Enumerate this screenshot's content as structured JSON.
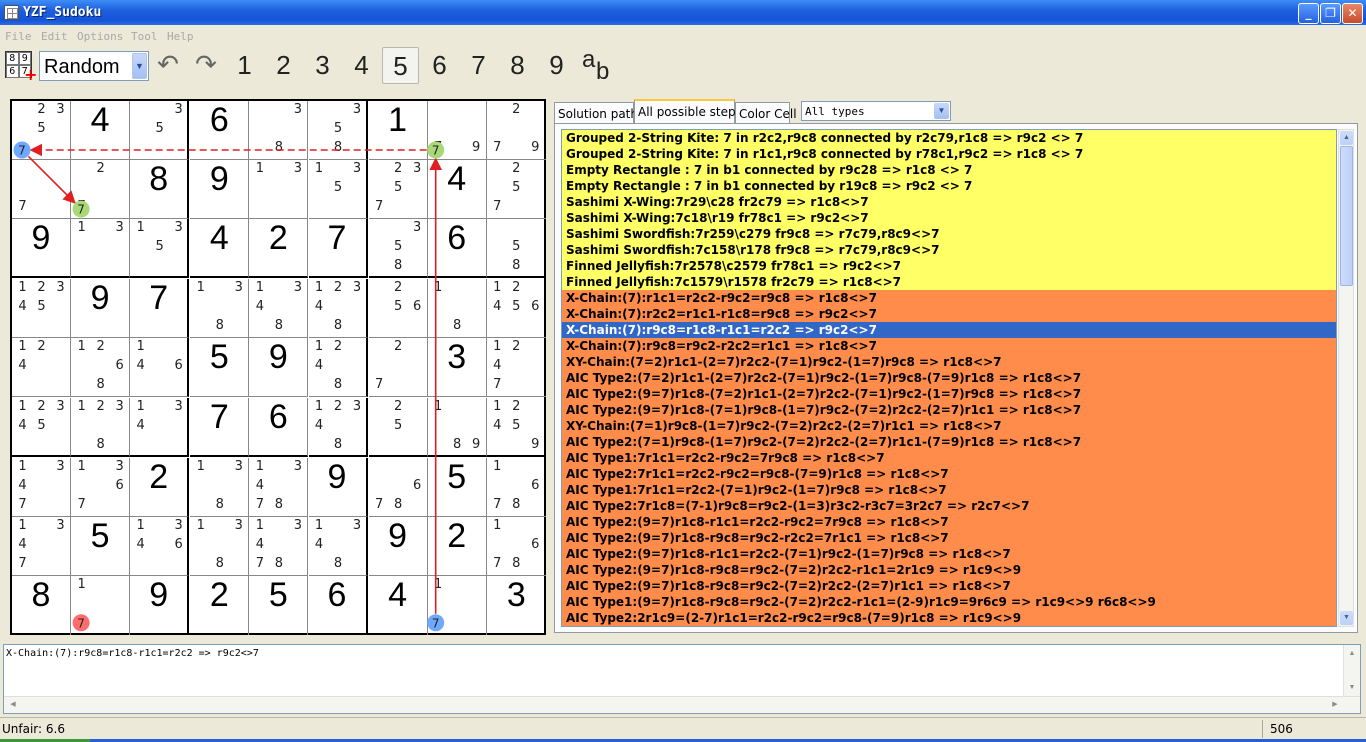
{
  "window": {
    "title": "YZF_Sudoku",
    "minimize": "_",
    "maximize": "❐",
    "close": "✕"
  },
  "menu": [
    "File",
    "Edit",
    "Options",
    "Tool",
    "Help"
  ],
  "toolbar": {
    "grid_icon_digits": [
      "8",
      "9",
      "6",
      "7"
    ],
    "mode_select": "Random",
    "digits": [
      "1",
      "2",
      "3",
      "4",
      "5",
      "6",
      "7",
      "8",
      "9"
    ],
    "active_digit": "5",
    "ab_label": {
      "a": "a",
      "b": "b"
    }
  },
  "board": {
    "cells": [
      [
        {
          "c": "2 3 5"
        },
        {
          "v": "4"
        },
        {
          "c": "3 5"
        },
        {
          "v": "6"
        },
        {
          "c": "3 8"
        },
        {
          "c": "3 5 8"
        },
        {
          "v": "1"
        },
        {
          "c": "7 9"
        },
        {
          "c": "2 7 9"
        }
      ],
      [
        {
          "c": "7"
        },
        {
          "c": "2 7"
        },
        {
          "v": "8"
        },
        {
          "v": "9"
        },
        {
          "c": "1 3"
        },
        {
          "c": "1 3 5"
        },
        {
          "c": "2 3 5 7"
        },
        {
          "v": "4"
        },
        {
          "c": "2 5 7"
        }
      ],
      [
        {
          "v": "9"
        },
        {
          "c": "1 3"
        },
        {
          "c": "1 3 5"
        },
        {
          "v": "4"
        },
        {
          "v": "2"
        },
        {
          "v": "7"
        },
        {
          "c": "3 5 8"
        },
        {
          "v": "6"
        },
        {
          "c": "5 8"
        }
      ],
      [
        {
          "c": "1 2 3 4 5"
        },
        {
          "v": "9"
        },
        {
          "v": "7"
        },
        {
          "c": "1 3 8"
        },
        {
          "c": "1 3 4 8"
        },
        {
          "c": "1 2 3 4 8"
        },
        {
          "c": "2 5 6"
        },
        {
          "c": "1 8"
        },
        {
          "c": "1 2 4 5 6"
        }
      ],
      [
        {
          "c": "1 2 4"
        },
        {
          "c": "1 2 6 8"
        },
        {
          "c": "1 4 6"
        },
        {
          "v": "5"
        },
        {
          "v": "9"
        },
        {
          "c": "1 2 4 8"
        },
        {
          "c": "2 7"
        },
        {
          "v": "3"
        },
        {
          "c": "1 2 4 7"
        }
      ],
      [
        {
          "c": "1 2 3 4 5"
        },
        {
          "c": "1 2 3 8"
        },
        {
          "c": "1 3 4"
        },
        {
          "v": "7"
        },
        {
          "v": "6"
        },
        {
          "c": "1 2 3 4 8"
        },
        {
          "c": "2 5"
        },
        {
          "c": "1 8 9"
        },
        {
          "c": "1 2 4 5 9"
        }
      ],
      [
        {
          "c": "1 3 4 7"
        },
        {
          "c": "1 3 6 7"
        },
        {
          "v": "2"
        },
        {
          "c": "1 3 8"
        },
        {
          "c": "1 3 4 7 8"
        },
        {
          "v": "9"
        },
        {
          "c": "6 7 8"
        },
        {
          "v": "5"
        },
        {
          "c": "1 6 7 8"
        }
      ],
      [
        {
          "c": "1 3 4 7"
        },
        {
          "v": "5"
        },
        {
          "c": "1 3 4 6"
        },
        {
          "c": "1 3 8"
        },
        {
          "c": "1 3 4 7 8"
        },
        {
          "c": "1 3 4 8"
        },
        {
          "v": "9"
        },
        {
          "v": "2"
        },
        {
          "c": "1 6 7 8"
        }
      ],
      [
        {
          "v": "8"
        },
        {
          "c": "1 7"
        },
        {
          "v": "9"
        },
        {
          "v": "2"
        },
        {
          "v": "5"
        },
        {
          "v": "6"
        },
        {
          "v": "4"
        },
        {
          "c": "1 7"
        },
        {
          "v": "3"
        }
      ]
    ],
    "chain": {
      "nodes": [
        {
          "r": 1,
          "c": 1,
          "d": 7,
          "color": "#6fa8ff"
        },
        {
          "r": 1,
          "c": 8,
          "d": 7,
          "color": "#a8d878"
        },
        {
          "r": 2,
          "c": 2,
          "d": 7,
          "color": "#a8d878"
        },
        {
          "r": 9,
          "c": 2,
          "d": 7,
          "color": "#ff6c6c"
        },
        {
          "r": 9,
          "c": 8,
          "d": 7,
          "color": "#6fa8ff"
        }
      ],
      "link_color": "#e02020"
    }
  },
  "panel": {
    "tabs": [
      "Solution path",
      "All possible steps",
      "Color Cell"
    ],
    "active_tab": 1,
    "filter": "All types",
    "steps": [
      {
        "t": "Grouped 2-String Kite: 7 in r2c2,r9c8 connected by r2c79,r1c8 => r9c2 <> 7",
        "k": "y"
      },
      {
        "t": "Grouped 2-String Kite: 7 in r1c1,r9c8 connected by r78c1,r9c2 => r1c8 <> 7",
        "k": "y"
      },
      {
        "t": "Empty Rectangle : 7 in b1 connected by r9c28 => r1c8 <> 7",
        "k": "y"
      },
      {
        "t": "Empty Rectangle : 7 in b1 connected by r19c8 => r9c2 <> 7",
        "k": "y"
      },
      {
        "t": "Sashimi X-Wing:7r29\\c28 fr2c79 => r1c8<>7",
        "k": "y"
      },
      {
        "t": "Sashimi X-Wing:7c18\\r19 fr78c1 => r9c2<>7",
        "k": "y"
      },
      {
        "t": "Sashimi Swordfish:7r259\\c279 fr9c8 => r7c79,r8c9<>7",
        "k": "y"
      },
      {
        "t": "Sashimi Swordfish:7c158\\r178 fr9c8 => r7c79,r8c9<>7",
        "k": "y"
      },
      {
        "t": "Finned Jellyfish:7r2578\\c2579 fr78c1 => r9c2<>7",
        "k": "y"
      },
      {
        "t": "Finned Jellyfish:7c1579\\r1578 fr2c79 => r1c8<>7",
        "k": "y"
      },
      {
        "t": "X-Chain:(7):r1c1=r2c2-r9c2=r9c8 => r1c8<>7",
        "k": "o"
      },
      {
        "t": "X-Chain:(7):r2c2=r1c1-r1c8=r9c8 => r9c2<>7",
        "k": "o"
      },
      {
        "t": "X-Chain:(7):r9c8=r1c8-r1c1=r2c2 => r9c2<>7",
        "k": "sel"
      },
      {
        "t": "X-Chain:(7):r9c8=r9c2-r2c2=r1c1 => r1c8<>7",
        "k": "o"
      },
      {
        "t": "XY-Chain:(7=2)r1c1-(2=7)r2c2-(7=1)r9c2-(1=7)r9c8 => r1c8<>7",
        "k": "o"
      },
      {
        "t": "AIC Type2:(7=2)r1c1-(2=7)r2c2-(7=1)r9c2-(1=7)r9c8-(7=9)r1c8 => r1c8<>7",
        "k": "o"
      },
      {
        "t": "AIC Type2:(9=7)r1c8-(7=2)r1c1-(2=7)r2c2-(7=1)r9c2-(1=7)r9c8 => r1c8<>7",
        "k": "o"
      },
      {
        "t": "AIC Type2:(9=7)r1c8-(7=1)r9c8-(1=7)r9c2-(7=2)r2c2-(2=7)r1c1 => r1c8<>7",
        "k": "o"
      },
      {
        "t": "XY-Chain:(7=1)r9c8-(1=7)r9c2-(7=2)r2c2-(2=7)r1c1 => r1c8<>7",
        "k": "o"
      },
      {
        "t": "AIC Type2:(7=1)r9c8-(1=7)r9c2-(7=2)r2c2-(2=7)r1c1-(7=9)r1c8 => r1c8<>7",
        "k": "o"
      },
      {
        "t": "AIC Type1:7r1c1=r2c2-r9c2=7r9c8 => r1c8<>7",
        "k": "o"
      },
      {
        "t": "AIC Type2:7r1c1=r2c2-r9c2=r9c8-(7=9)r1c8 => r1c8<>7",
        "k": "o"
      },
      {
        "t": "AIC Type1:7r1c1=r2c2-(7=1)r9c2-(1=7)r9c8 => r1c8<>7",
        "k": "o"
      },
      {
        "t": "AIC Type2:7r1c8=(7-1)r9c8=r9c2-(1=3)r3c2-r3c7=3r2c7 => r2c7<>7",
        "k": "o"
      },
      {
        "t": "AIC Type2:(9=7)r1c8-r1c1=r2c2-r9c2=7r9c8 => r1c8<>7",
        "k": "o"
      },
      {
        "t": "AIC Type2:(9=7)r1c8-r9c8=r9c2-r2c2=7r1c1 => r1c8<>7",
        "k": "o"
      },
      {
        "t": "AIC Type2:(9=7)r1c8-r1c1=r2c2-(7=1)r9c2-(1=7)r9c8 => r1c8<>7",
        "k": "o"
      },
      {
        "t": "AIC Type2:(9=7)r1c8-r9c8=r9c2-(7=2)r2c2-r1c1=2r1c9 => r1c9<>9",
        "k": "o"
      },
      {
        "t": "AIC Type2:(9=7)r1c8-r9c8=r9c2-(7=2)r2c2-(2=7)r1c1 => r1c8<>7",
        "k": "o"
      },
      {
        "t": "AIC Type1:(9=7)r1c8-r9c8=r9c2-(7=2)r2c2-r1c1=(2-9)r1c9=9r6c9 => r1c9<>9 r6c8<>9",
        "k": "o"
      },
      {
        "t": "AIC Type2:2r1c9=(2-7)r1c1=r2c2-r9c2=r9c8-(7=9)r1c8 => r1c9<>9",
        "k": "o"
      }
    ]
  },
  "output": {
    "text": "X-Chain:(7):r9c8=r1c8-r1c1=r2c2 => r9c2<>7"
  },
  "status": {
    "left": "Unfair: 6.6",
    "right": "506"
  }
}
